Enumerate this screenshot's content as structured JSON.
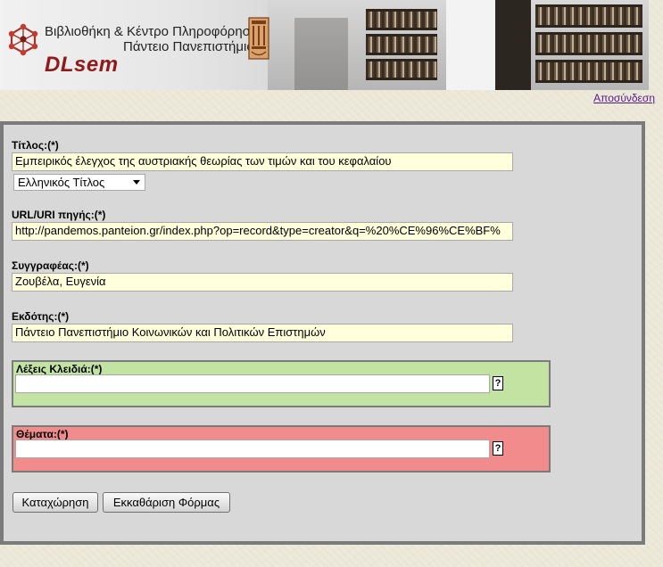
{
  "header": {
    "title_line1": "Βιβλιοθήκη & Κέντρο Πληροφόρησης",
    "title_line2": "Πάντειο Πανεπιστήμιο",
    "brand": "DLsem"
  },
  "logout_label": "Αποσύνδεση",
  "form": {
    "title": {
      "label": "Τίτλος:(*)",
      "value": "Εμπειρικός έλεγχος της αυστριακής θεωρίας των τιμών και του κεφαλαίου"
    },
    "title_type": {
      "selected": "Ελληνικός Τίτλος"
    },
    "url": {
      "label": "URL/URI πηγής:(*)",
      "value": "http://pandemos.panteion.gr/index.php?op=record&type=creator&q=%20%CE%96%CE%BF%"
    },
    "author": {
      "label": "Συγγραφέας:(*)",
      "value": "Ζουβέλα, Ευγενία"
    },
    "publisher": {
      "label": "Εκδότης:(*)",
      "value": "Πάντειο Πανεπιστήμιο Κοινωνικών και Πολιτικών Επιστημών"
    },
    "keywords": {
      "label": "Λέξεις Κλειδιά:(*)",
      "value": "",
      "help": "?"
    },
    "subjects": {
      "label": "Θέματα:(*)",
      "value": "",
      "help": "?"
    },
    "submit_label": "Καταχώρηση",
    "clear_label": "Εκκαθάριση Φόρμας"
  },
  "colors": {
    "brand": "#8e1a1a",
    "keywords_bg": "#c3e3a2",
    "subjects_bg": "#f28c8c",
    "input_bg": "#ffffdb",
    "panel_bg": "#d8d8d8",
    "panel_border": "#7b7b7b"
  },
  "icons": {
    "logo": "network-logo-icon",
    "crest": "university-crest-icon",
    "select_arrow": "chevron-down-icon"
  }
}
